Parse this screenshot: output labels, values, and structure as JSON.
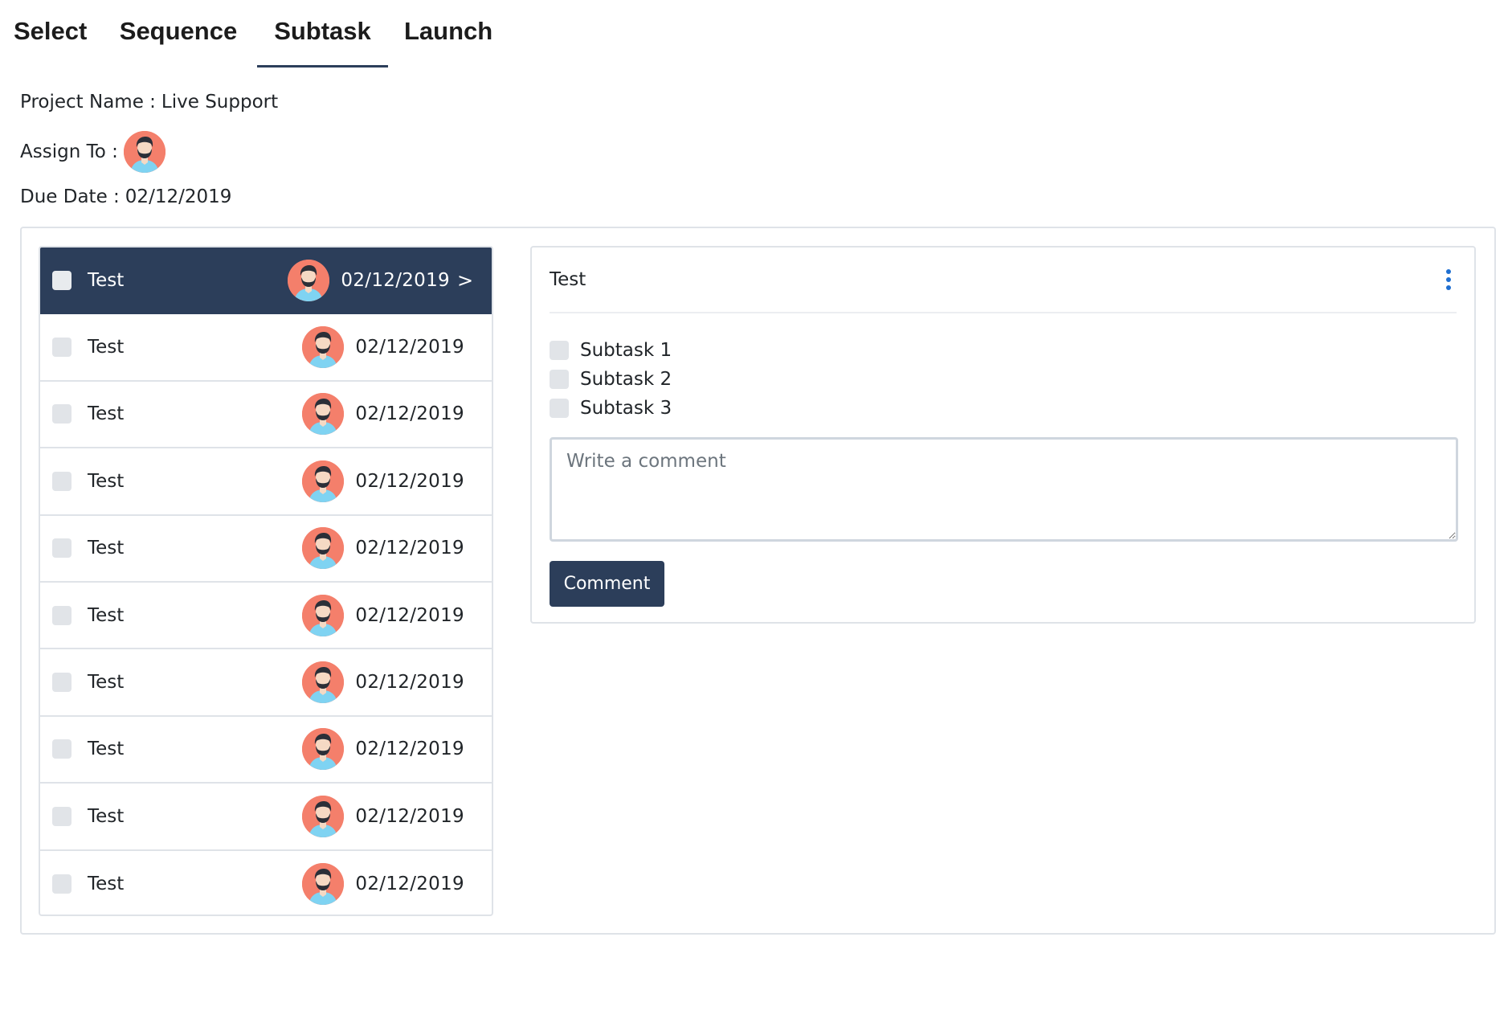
{
  "tabs": [
    {
      "label": "Select"
    },
    {
      "label": "Sequence"
    },
    {
      "label": "Subtask"
    },
    {
      "label": "Launch"
    }
  ],
  "active_tab": "Subtask",
  "project": {
    "name_label": "Project Name :",
    "name_value": "Live Support",
    "assign_label": "Assign To :",
    "due_label": "Due Date :",
    "due_value": "02/12/2019"
  },
  "tasks": [
    {
      "title": "Test",
      "date": "02/12/2019",
      "arrow": ">"
    },
    {
      "title": "Test",
      "date": "02/12/2019"
    },
    {
      "title": "Test",
      "date": "02/12/2019"
    },
    {
      "title": "Test",
      "date": "02/12/2019"
    },
    {
      "title": "Test",
      "date": "02/12/2019"
    },
    {
      "title": "Test",
      "date": "02/12/2019"
    },
    {
      "title": "Test",
      "date": "02/12/2019"
    },
    {
      "title": "Test",
      "date": "02/12/2019"
    },
    {
      "title": "Test",
      "date": "02/12/2019"
    },
    {
      "title": "Test",
      "date": "02/12/2019"
    }
  ],
  "detail": {
    "title": "Test",
    "subtasks": [
      {
        "label": "Subtask 1"
      },
      {
        "label": "Subtask 2"
      },
      {
        "label": "Subtask 3"
      }
    ],
    "comment_placeholder": "Write a comment",
    "comment_button": "Comment"
  },
  "colors": {
    "primary": "#2c3e5a",
    "avatar_bg": "#f47f6b",
    "kebab": "#1f6fd1",
    "border": "#dfe3e8"
  }
}
